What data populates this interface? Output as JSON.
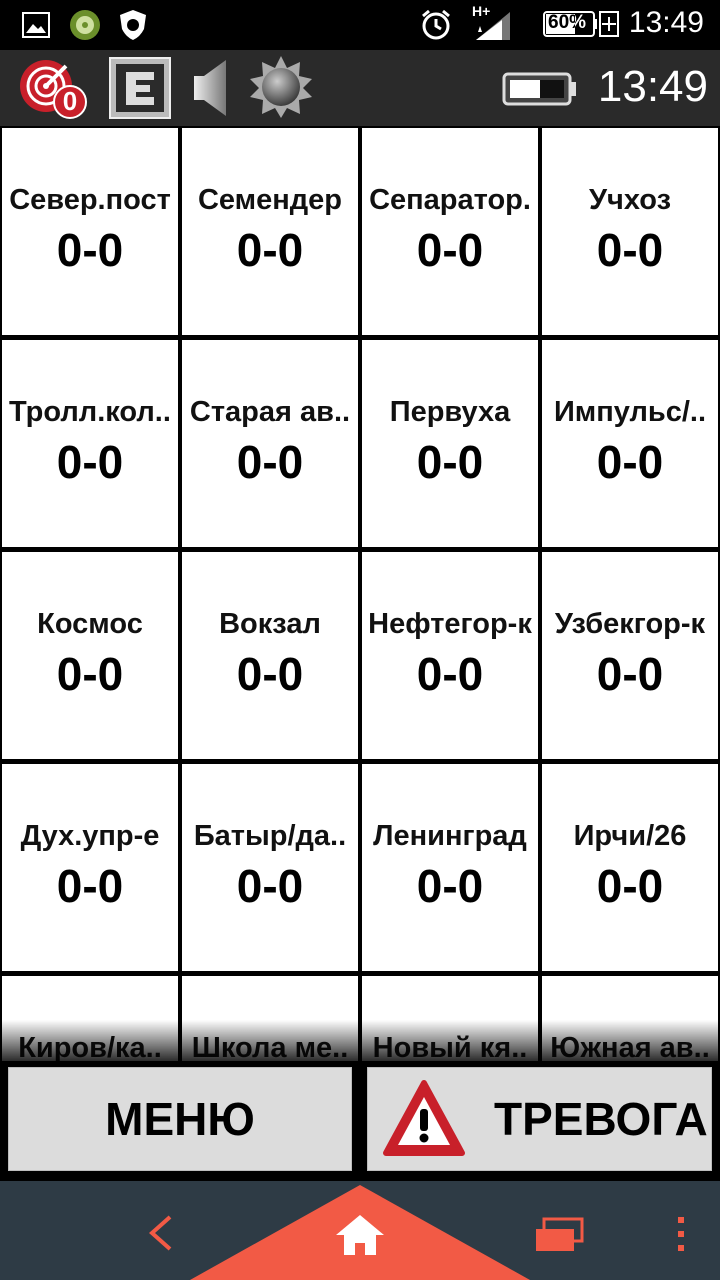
{
  "status_bar": {
    "battery_percent": "60%",
    "time": "13:49",
    "network": "H+",
    "icons": [
      "image-icon",
      "wheel-icon",
      "shield-bug-icon",
      "alarm-icon",
      "signal-icon",
      "battery-icon"
    ]
  },
  "toolbar": {
    "badge_count": "0",
    "time": "13:49",
    "icons": [
      "alert-radar-icon",
      "e-button-icon",
      "speaker-icon",
      "sun-icon",
      "battery-icon"
    ]
  },
  "grid": {
    "cells": [
      {
        "name": "Север.пост",
        "score": "0-0"
      },
      {
        "name": "Семендер",
        "score": "0-0"
      },
      {
        "name": "Сепаратор.",
        "score": "0-0"
      },
      {
        "name": "Учхоз",
        "score": "0-0"
      },
      {
        "name": "Тролл.кол..",
        "score": "0-0"
      },
      {
        "name": "Старая ав..",
        "score": "0-0"
      },
      {
        "name": "Первуха",
        "score": "0-0"
      },
      {
        "name": "Импульс/..",
        "score": "0-0"
      },
      {
        "name": "Космос",
        "score": "0-0"
      },
      {
        "name": "Вокзал",
        "score": "0-0"
      },
      {
        "name": "Нефтегор-к",
        "score": "0-0"
      },
      {
        "name": "Узбекгор-к",
        "score": "0-0"
      },
      {
        "name": "Дух.упр-е",
        "score": "0-0"
      },
      {
        "name": "Батыр/да..",
        "score": "0-0"
      },
      {
        "name": "Ленинград",
        "score": "0-0"
      },
      {
        "name": "Ирчи/26",
        "score": "0-0"
      },
      {
        "name": "Киров/ка..",
        "score": ""
      },
      {
        "name": "Школа ме..",
        "score": ""
      },
      {
        "name": "Новый кя..",
        "score": ""
      },
      {
        "name": "Южная ав..",
        "score": ""
      }
    ]
  },
  "buttons": {
    "menu_label": "МЕНЮ",
    "alarm_label": "ТРЕВОГА"
  },
  "navbar": {
    "icons": [
      "back-icon",
      "home-icon",
      "recents-icon",
      "more-icon"
    ],
    "accent_color": "#f25a45"
  }
}
